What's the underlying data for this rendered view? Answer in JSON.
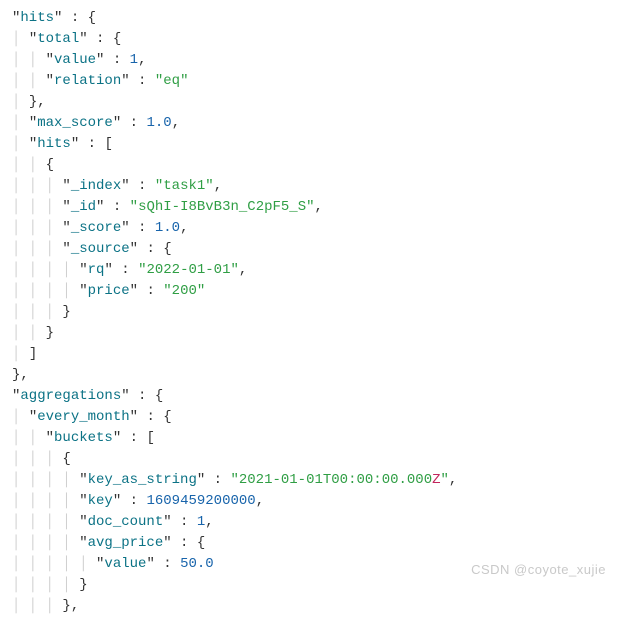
{
  "watermark": "CSDN @coyote_xujie",
  "json": {
    "hits": {
      "total": {
        "value": 1,
        "relation": "eq"
      },
      "max_score": 1.0,
      "hits": [
        {
          "_index": "task1",
          "_id": "sQhI-I8BvB3n_C2pF5_S",
          "_score": 1.0,
          "_source": {
            "rq": "2022-01-01",
            "price": "200"
          }
        }
      ]
    },
    "aggregations": {
      "every_month": {
        "buckets": [
          {
            "key_as_string": "2021-01-01T00:00:00.000Z",
            "key": 1609459200000,
            "doc_count": 1,
            "avg_price": {
              "value": 50.0
            }
          }
        ]
      }
    }
  },
  "lines": [
    {
      "g": "",
      "tokens": [
        {
          "t": "key",
          "v": "hits"
        },
        {
          "t": "p",
          "v": " : {"
        }
      ]
    },
    {
      "g": "│ ",
      "tokens": [
        {
          "t": "key",
          "v": "total"
        },
        {
          "t": "p",
          "v": " : {"
        }
      ]
    },
    {
      "g": "│ │ ",
      "tokens": [
        {
          "t": "key",
          "v": "value"
        },
        {
          "t": "p",
          "v": " : "
        },
        {
          "t": "num",
          "v": "1"
        },
        {
          "t": "p",
          "v": ","
        }
      ]
    },
    {
      "g": "│ │ ",
      "tokens": [
        {
          "t": "key",
          "v": "relation"
        },
        {
          "t": "p",
          "v": " : "
        },
        {
          "t": "str",
          "v": "eq"
        }
      ]
    },
    {
      "g": "│ ",
      "tokens": [
        {
          "t": "p",
          "v": "},"
        }
      ]
    },
    {
      "g": "│ ",
      "tokens": [
        {
          "t": "key",
          "v": "max_score"
        },
        {
          "t": "p",
          "v": " : "
        },
        {
          "t": "num",
          "v": "1.0"
        },
        {
          "t": "p",
          "v": ","
        }
      ]
    },
    {
      "g": "│ ",
      "tokens": [
        {
          "t": "key",
          "v": "hits"
        },
        {
          "t": "p",
          "v": " : ["
        }
      ]
    },
    {
      "g": "│ │ ",
      "tokens": [
        {
          "t": "p",
          "v": "{"
        }
      ]
    },
    {
      "g": "│ │ │ ",
      "tokens": [
        {
          "t": "key",
          "v": "_index"
        },
        {
          "t": "p",
          "v": " : "
        },
        {
          "t": "str",
          "v": "task1"
        },
        {
          "t": "p",
          "v": ","
        }
      ]
    },
    {
      "g": "│ │ │ ",
      "tokens": [
        {
          "t": "key",
          "v": "_id"
        },
        {
          "t": "p",
          "v": " : "
        },
        {
          "t": "str",
          "v": "sQhI-I8BvB3n_C2pF5_S"
        },
        {
          "t": "p",
          "v": ","
        }
      ]
    },
    {
      "g": "│ │ │ ",
      "tokens": [
        {
          "t": "key",
          "v": "_score"
        },
        {
          "t": "p",
          "v": " : "
        },
        {
          "t": "num",
          "v": "1.0"
        },
        {
          "t": "p",
          "v": ","
        }
      ]
    },
    {
      "g": "│ │ │ ",
      "tokens": [
        {
          "t": "key",
          "v": "_source"
        },
        {
          "t": "p",
          "v": " : {"
        }
      ]
    },
    {
      "g": "│ │ │ │ ",
      "tokens": [
        {
          "t": "key",
          "v": "rq"
        },
        {
          "t": "p",
          "v": " : "
        },
        {
          "t": "str",
          "v": "2022-01-01"
        },
        {
          "t": "p",
          "v": ","
        }
      ]
    },
    {
      "g": "│ │ │ │ ",
      "tokens": [
        {
          "t": "key",
          "v": "price"
        },
        {
          "t": "p",
          "v": " : "
        },
        {
          "t": "str",
          "v": "200"
        }
      ]
    },
    {
      "g": "│ │ │ ",
      "tokens": [
        {
          "t": "p",
          "v": "}"
        }
      ]
    },
    {
      "g": "│ │ ",
      "tokens": [
        {
          "t": "p",
          "v": "}"
        }
      ]
    },
    {
      "g": "│ ",
      "tokens": [
        {
          "t": "p",
          "v": "]"
        }
      ]
    },
    {
      "g": "",
      "tokens": [
        {
          "t": "p",
          "v": "},"
        }
      ]
    },
    {
      "g": "",
      "tokens": [
        {
          "t": "key",
          "v": "aggregations"
        },
        {
          "t": "p",
          "v": " : {"
        }
      ]
    },
    {
      "g": "│ ",
      "tokens": [
        {
          "t": "key",
          "v": "every_month"
        },
        {
          "t": "p",
          "v": " : {"
        }
      ]
    },
    {
      "g": "│ │ ",
      "tokens": [
        {
          "t": "key",
          "v": "buckets"
        },
        {
          "t": "p",
          "v": " : ["
        }
      ]
    },
    {
      "g": "│ │ │ ",
      "tokens": [
        {
          "t": "p",
          "v": "{"
        }
      ]
    },
    {
      "g": "│ │ │ │ ",
      "tokens": [
        {
          "t": "key",
          "v": "key_as_string"
        },
        {
          "t": "p",
          "v": " : "
        },
        {
          "t": "strz",
          "v": "2021-01-01T00:00:00.000",
          "z": "Z"
        },
        {
          "t": "p",
          "v": ","
        }
      ]
    },
    {
      "g": "│ │ │ │ ",
      "tokens": [
        {
          "t": "key",
          "v": "key"
        },
        {
          "t": "p",
          "v": " : "
        },
        {
          "t": "num",
          "v": "1609459200000"
        },
        {
          "t": "p",
          "v": ","
        }
      ]
    },
    {
      "g": "│ │ │ │ ",
      "tokens": [
        {
          "t": "key",
          "v": "doc_count"
        },
        {
          "t": "p",
          "v": " : "
        },
        {
          "t": "num",
          "v": "1"
        },
        {
          "t": "p",
          "v": ","
        }
      ]
    },
    {
      "g": "│ │ │ │ ",
      "tokens": [
        {
          "t": "key",
          "v": "avg_price"
        },
        {
          "t": "p",
          "v": " : {"
        }
      ]
    },
    {
      "g": "│ │ │ │ │ ",
      "tokens": [
        {
          "t": "key",
          "v": "value"
        },
        {
          "t": "p",
          "v": " : "
        },
        {
          "t": "num",
          "v": "50.0"
        }
      ]
    },
    {
      "g": "│ │ │ │ ",
      "tokens": [
        {
          "t": "p",
          "v": "}"
        }
      ]
    },
    {
      "g": "│ │ │ ",
      "tokens": [
        {
          "t": "p",
          "v": "},"
        }
      ]
    }
  ]
}
